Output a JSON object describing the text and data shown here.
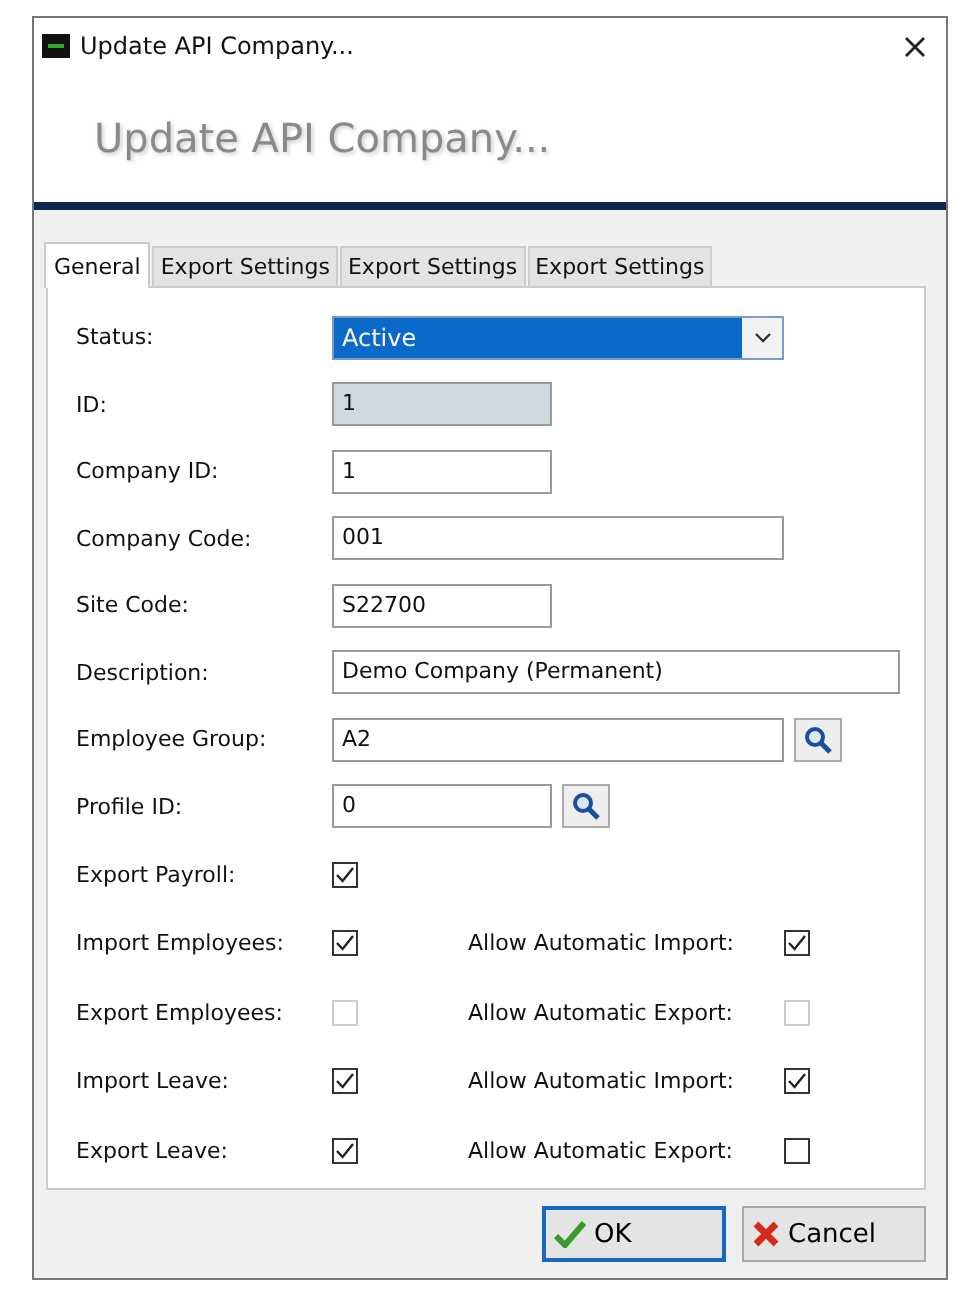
{
  "window": {
    "title": "Update API Company...",
    "heading": "Update API Company..."
  },
  "tabs": [
    {
      "label": "General",
      "selected": true
    },
    {
      "label": "Export Settings",
      "selected": false
    },
    {
      "label": "Export Settings",
      "selected": false
    },
    {
      "label": "Export Settings",
      "selected": false
    }
  ],
  "fields": [
    {
      "label": "Status:",
      "kind": "dropdown",
      "value": "Active"
    },
    {
      "label": "ID:",
      "kind": "readonly",
      "value": "1"
    },
    {
      "label": "Company ID:",
      "kind": "text",
      "value": "1"
    },
    {
      "label": "Company Code:",
      "kind": "text",
      "value": "001"
    },
    {
      "label": "Site Code:",
      "kind": "text",
      "value": "S22700"
    },
    {
      "label": "Description:",
      "kind": "text",
      "value": "Demo Company (Permanent)"
    },
    {
      "label": "Employee Group:",
      "kind": "lookup",
      "value": "A2"
    },
    {
      "label": "Profile ID:",
      "kind": "lookup",
      "value": "0"
    }
  ],
  "checks": [
    {
      "left": {
        "label": "Export Payroll:",
        "checked": true,
        "disabled": false
      }
    },
    {
      "left": {
        "label": "Import Employees:",
        "checked": true,
        "disabled": false
      },
      "right": {
        "label": "Allow Automatic Import:",
        "checked": true,
        "disabled": false
      }
    },
    {
      "left": {
        "label": "Export Employees:",
        "checked": false,
        "disabled": true
      },
      "right": {
        "label": "Allow Automatic Export:",
        "checked": false,
        "disabled": true
      }
    },
    {
      "left": {
        "label": "Import Leave:",
        "checked": true,
        "disabled": false
      },
      "right": {
        "label": "Allow Automatic Import:",
        "checked": true,
        "disabled": false
      }
    },
    {
      "left": {
        "label": "Export Leave:",
        "checked": true,
        "disabled": false
      },
      "right": {
        "label": "Allow Automatic Export:",
        "checked": false,
        "disabled": false
      }
    }
  ],
  "buttons": [
    {
      "label": "OK",
      "kind": "ok"
    },
    {
      "label": "Cancel",
      "kind": "cancel"
    }
  ]
}
